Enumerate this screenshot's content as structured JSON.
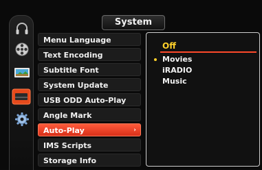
{
  "header": {
    "title": "System"
  },
  "sidebar": {
    "icons": [
      "headphones-icon",
      "film-reel-icon",
      "photo-icon",
      "display-icon",
      "gear-icon"
    ],
    "active_icon": "display-icon"
  },
  "menu": {
    "items": [
      {
        "label": "Menu Language"
      },
      {
        "label": "Text Encoding"
      },
      {
        "label": "Subtitle Font"
      },
      {
        "label": "System Update"
      },
      {
        "label": "USB ODD Auto-Play"
      },
      {
        "label": "Angle Mark"
      },
      {
        "label": "Auto-Play",
        "active": true
      },
      {
        "label": "IMS Scripts"
      },
      {
        "label": "Storage Info"
      }
    ],
    "active_arrow": "›"
  },
  "submenu": {
    "options": [
      {
        "label": "Off",
        "selected": true
      },
      {
        "label": "Movies",
        "current": true
      },
      {
        "label": "iRADIO"
      },
      {
        "label": "Music"
      }
    ]
  },
  "colors": {
    "accent": "#e33a1e",
    "highlight_text": "#ffd02a"
  }
}
